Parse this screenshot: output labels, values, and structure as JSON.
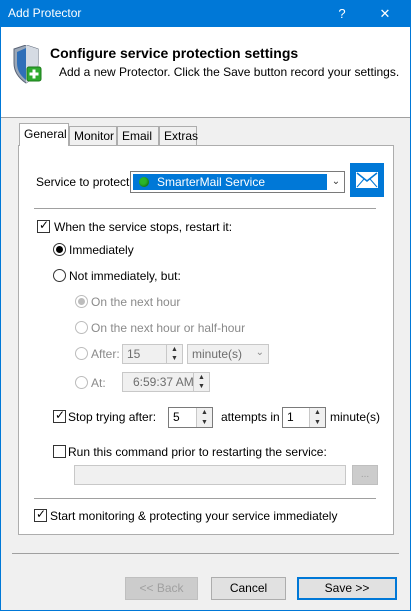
{
  "window": {
    "title": "Add Protector",
    "help_label": "?",
    "close_label": "✕"
  },
  "header": {
    "title": "Configure service protection settings",
    "subtitle": "Add a new Protector. Click the Save button record your settings."
  },
  "tabs": [
    "General",
    "Monitor",
    "Email",
    "Extras"
  ],
  "general": {
    "service_label": "Service to protect:",
    "service_value": "SmarterMail Service",
    "restart_label": "When the service stops, restart it:",
    "immediately_label": "Immediately",
    "not_immediately_label": "Not immediately, but:",
    "next_hour_label": "On the next hour",
    "next_half_hour_label": "On the next hour or half-hour",
    "after_label": "After:",
    "after_value": "15",
    "after_unit": "minute(s)",
    "at_label": "At:",
    "at_value": "6:59:37 AM",
    "stop_trying_label": "Stop trying after:",
    "stop_attempts_value": "5",
    "attempts_in_label": "attempts in",
    "attempts_minutes_value": "1",
    "minutes_label": "minute(s)",
    "run_command_label": "Run this command prior to restarting the service:",
    "command_value": "",
    "browse_label": "...",
    "start_monitoring_label": "Start monitoring & protecting your service immediately"
  },
  "footer": {
    "back_label": "<< Back",
    "cancel_label": "Cancel",
    "save_label": "Save >>"
  },
  "colors": {
    "titlebar": "#0078d7",
    "selected_item": "#0078d7",
    "service_status": "#2bb52b"
  }
}
